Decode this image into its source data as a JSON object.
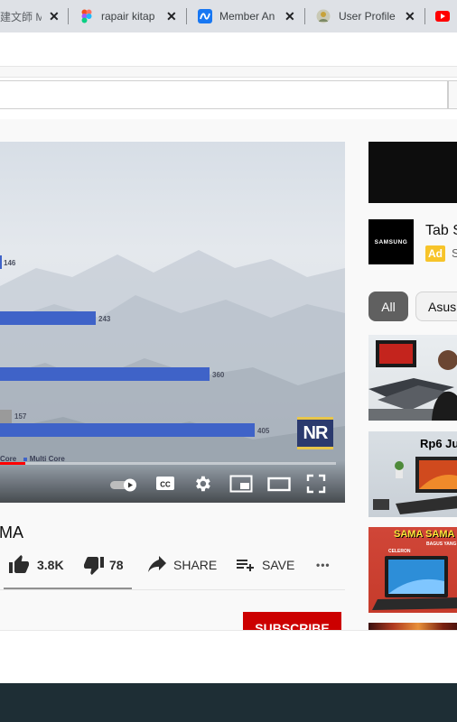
{
  "browser": {
    "tabs": [
      {
        "title": "建文師 M",
        "favicon": "document-icon"
      },
      {
        "title": "rapair kitap",
        "favicon": "figma-icon"
      },
      {
        "title": "Member An",
        "favicon": "meta-icon"
      },
      {
        "title": "User Profile",
        "favicon": "user-profile-icon"
      },
      {
        "title": "",
        "favicon": "youtube-icon"
      }
    ]
  },
  "player": {
    "bars": [
      {
        "label": "146"
      },
      {
        "label": "243"
      },
      {
        "label": "360"
      },
      {
        "label": "157"
      },
      {
        "label": "405"
      }
    ],
    "bar_values": [
      146,
      243,
      360,
      157,
      405
    ],
    "legend_single": "Core",
    "legend_multi": "Multi Core",
    "channel_logo": "NR",
    "progress": 0.07
  },
  "video": {
    "title": "MA",
    "like_count": "3.8K",
    "dislike_count": "78",
    "share_label": "SHARE",
    "save_label": "SAVE",
    "more_label": "•••",
    "subscribe_label": "SUBSCRIBE"
  },
  "sidebar": {
    "ad_logo": "SAMSUNG",
    "ad_title": "Tab S",
    "ad_badge": "Ad",
    "ad_sub": "S",
    "chips": [
      {
        "label": "All"
      },
      {
        "label": "Asus"
      }
    ],
    "thumbnails": [
      {
        "overlay_text": ""
      },
      {
        "overlay_text": "Rp6 Ju"
      },
      {
        "overlay_text": "SAMA SAMA",
        "sub_text": "BAGUS YANG",
        "tag": "CELERON"
      }
    ]
  },
  "colors": {
    "accent_red": "#cc0000",
    "bar_blue": "#3f63c8",
    "bar_gray": "#9a9a9a"
  }
}
